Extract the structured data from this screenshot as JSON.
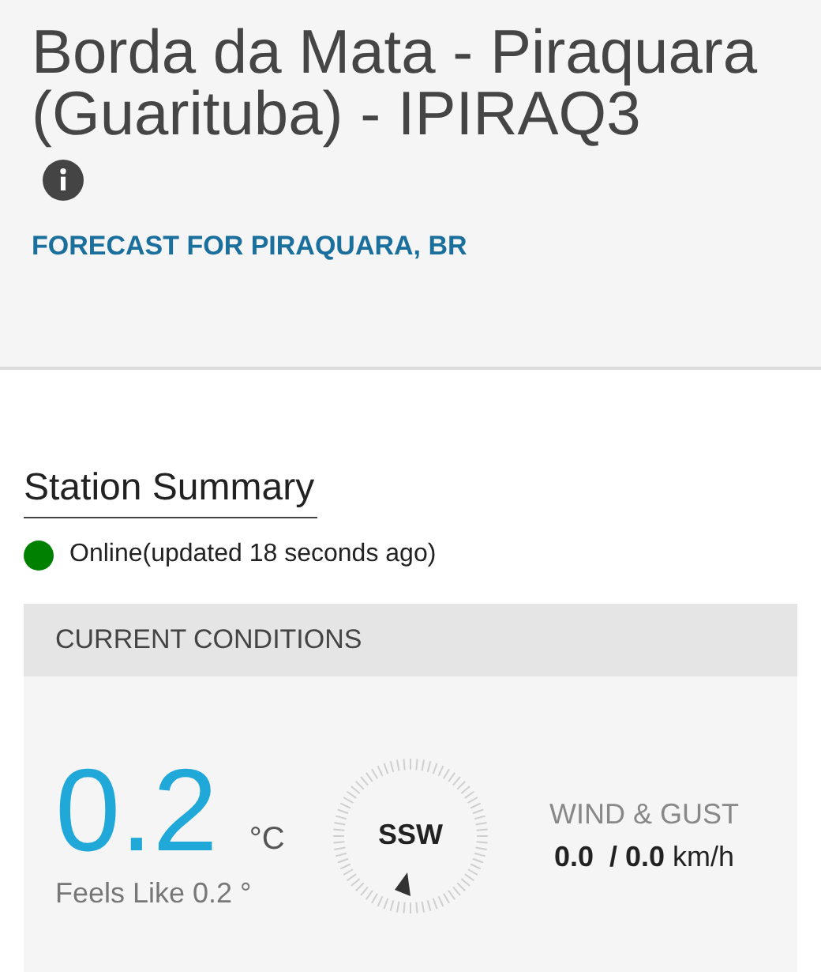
{
  "station": {
    "title": "Borda da Mata - Piraquara (Guarituba) - IPIRAQ3",
    "forecast_link": "FORECAST FOR PIRAQUARA, BR"
  },
  "summary": {
    "heading": "Station Summary",
    "online": true,
    "status": "Online(updated 18 seconds ago)"
  },
  "current_conditions": {
    "heading": "CURRENT CONDITIONS",
    "temperature": "0.2",
    "unit": "°C",
    "feels_like": "Feels Like 0.2 °",
    "wind_direction": "SSW",
    "wind_label": "WIND & GUST",
    "wind_value": "**0.0  / 0.0** km/h"
  }
}
